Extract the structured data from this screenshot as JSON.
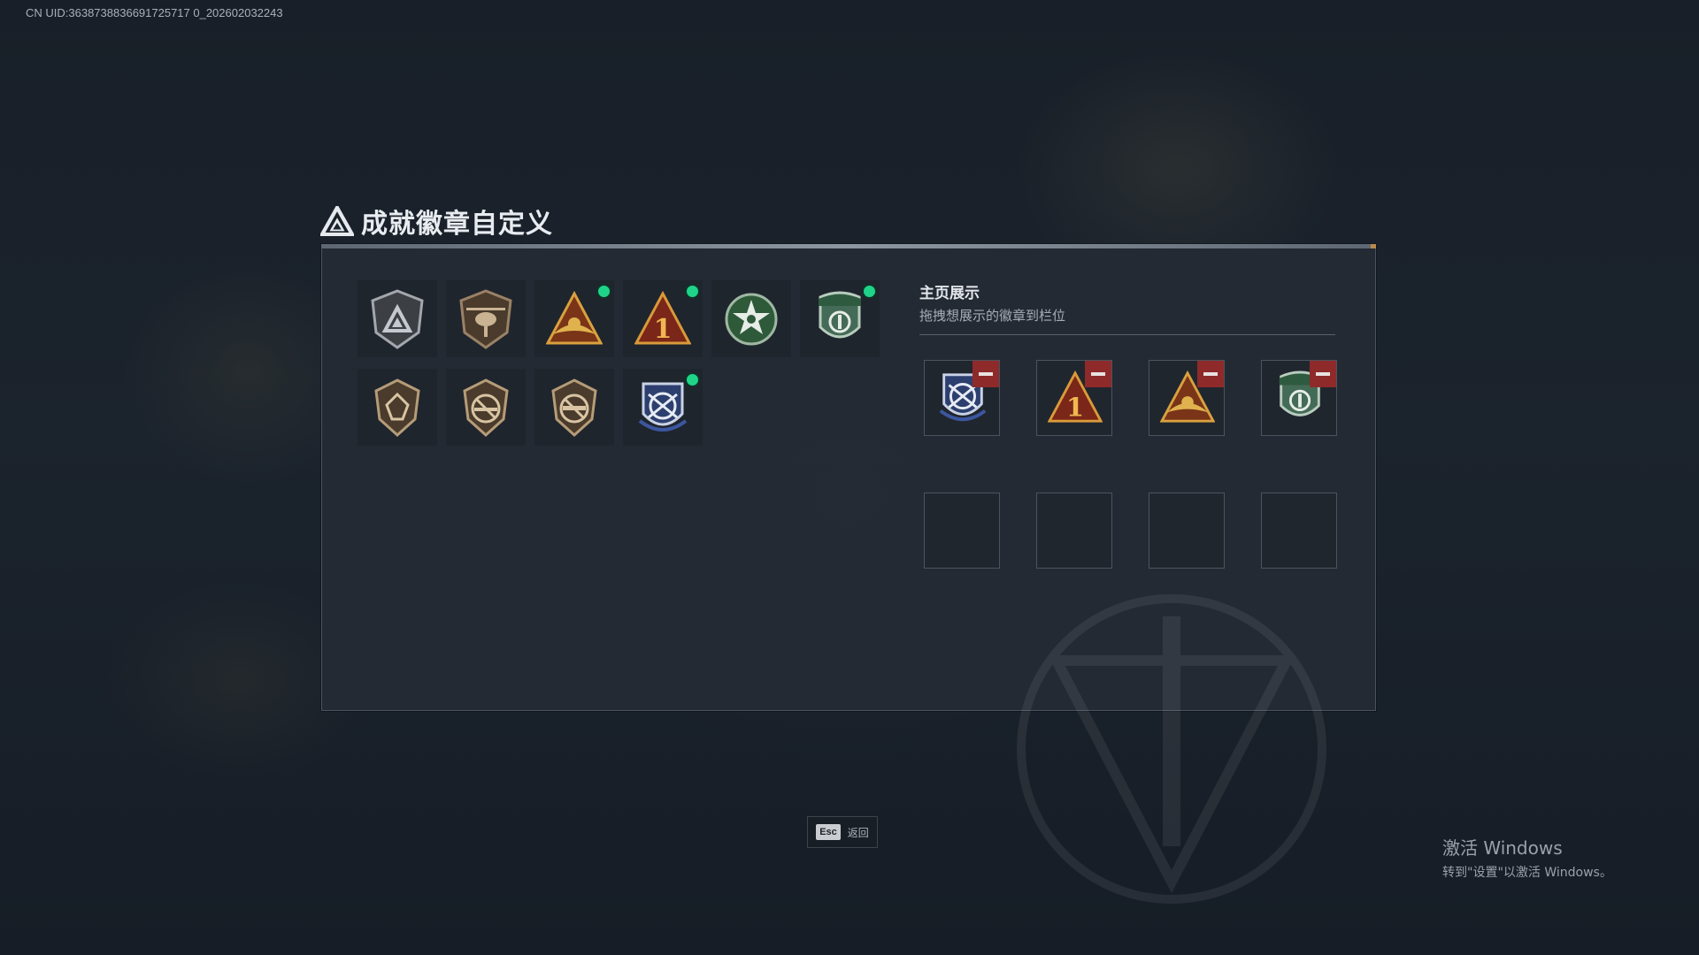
{
  "uid_text": "CN UID:3638738836691725717 0_202602032243",
  "title": "成就徽章自定义",
  "inventory": {
    "badges": [
      {
        "icon": "silver-triangle-badge-icon",
        "new": false
      },
      {
        "icon": "helicopter-badge-icon",
        "new": false
      },
      {
        "icon": "gold-triangle-eagle-badge-icon",
        "new": true
      },
      {
        "icon": "number-one-triangle-badge-icon",
        "new": true
      },
      {
        "icon": "green-star-badge-icon",
        "new": true
      },
      {
        "icon": "green-medic-shield-badge-icon",
        "new": true
      },
      {
        "icon": "brown-crest-badge-icon",
        "new": false
      },
      {
        "icon": "no-rifle-badge-icon",
        "new": false
      },
      {
        "icon": "no-rifle-badge-2-icon",
        "new": false
      },
      {
        "icon": "blue-crossed-rifles-badge-icon",
        "new": true
      }
    ]
  },
  "showcase": {
    "title": "主页展示",
    "subtitle": "拖拽想展示的徽章到栏位",
    "slots": [
      {
        "icon": "blue-crossed-rifles-badge-icon",
        "filled": true
      },
      {
        "icon": "number-one-triangle-badge-icon",
        "filled": true
      },
      {
        "icon": "gold-triangle-eagle-badge-icon",
        "filled": true
      },
      {
        "icon": "green-medic-shield-badge-icon",
        "filled": true
      },
      {
        "filled": false
      },
      {
        "filled": false
      },
      {
        "filled": false
      },
      {
        "filled": false
      }
    ]
  },
  "footer": {
    "esc_key": "Esc",
    "esc_label": "返回"
  },
  "windows_watermark": {
    "line1": "激活 Windows",
    "line2": "转到\"设置\"以激活 Windows。"
  },
  "colors": {
    "new_indicator": "#1fd488",
    "remove_button": "#8f2a2a",
    "panel_bg": "#242b34"
  }
}
